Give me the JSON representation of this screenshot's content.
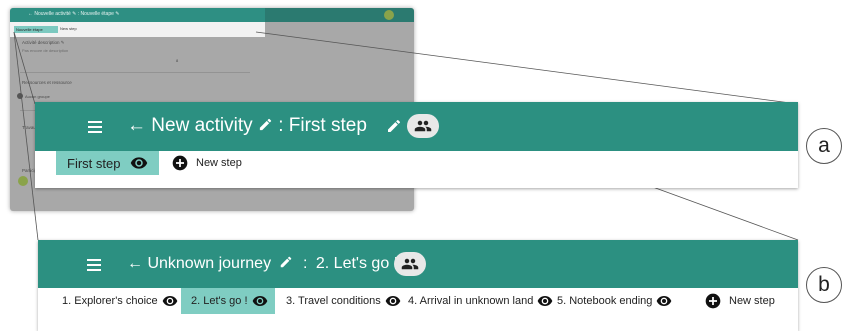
{
  "thumbnail": {
    "title": "← Nouvelle activité ✎ : Nouvelle étape ✎",
    "steps": [
      "Nouvelle étape",
      "New step"
    ],
    "section1": "Activité description ✎",
    "section1_sub": "Pas encore de description",
    "center_mark": "8",
    "section2": "Ressources et ressource",
    "section2_item": "Aucun groupe",
    "section3": "Travaux de groupe",
    "section4": "Participants"
  },
  "panel_a": {
    "activity_title": "New activity",
    "separator": ":",
    "step_title": "First step",
    "steps": [
      {
        "label": "First step",
        "active": true
      },
      {
        "label": "New step",
        "is_add": true
      }
    ]
  },
  "panel_b": {
    "journey_title": "Unknown journey",
    "separator": ":",
    "step_title": "2. Let's go !",
    "steps": [
      {
        "label": "1. Explorer's choice",
        "active": false
      },
      {
        "label": "2. Let's go !",
        "active": true
      },
      {
        "label": "3. Travel conditions",
        "active": false
      },
      {
        "label": "4. Arrival in unknown land",
        "active": false
      },
      {
        "label": "5. Notebook ending",
        "active": false
      },
      {
        "label": "New step",
        "is_add": true
      }
    ]
  },
  "labels": {
    "a": "a",
    "b": "b"
  },
  "colors": {
    "appbar": "#2c9081",
    "active_step": "#7fcdc2"
  }
}
